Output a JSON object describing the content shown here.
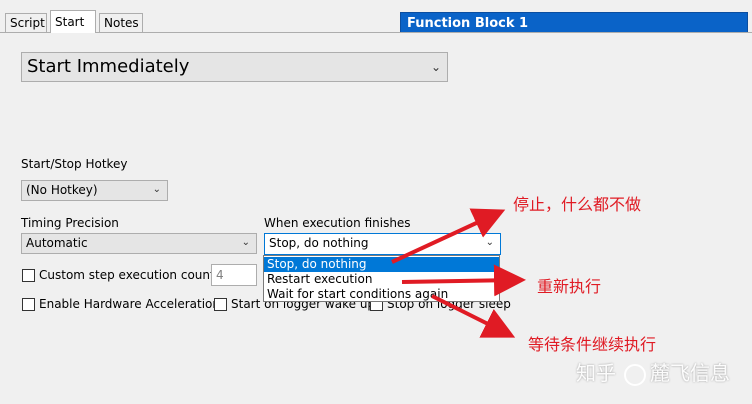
{
  "tabs": [
    {
      "label": "Script",
      "active": false
    },
    {
      "label": "Start",
      "active": true
    },
    {
      "label": "Notes",
      "active": false
    }
  ],
  "panel_title": "Function Block 1",
  "start_mode": {
    "value": "Start Immediately"
  },
  "hotkey": {
    "label": "Start/Stop Hotkey",
    "value": "(No Hotkey)"
  },
  "timing": {
    "label": "Timing Precision",
    "value": "Automatic"
  },
  "when_finishes": {
    "label": "When execution finishes",
    "value": "Stop, do nothing",
    "options": [
      "Stop, do nothing",
      "Restart execution",
      "Wait for start conditions again"
    ],
    "selected_index": 0
  },
  "custom_step": {
    "label": "Custom step execution count:",
    "value": "4",
    "checked": false
  },
  "hardware_accel": {
    "label": "Enable Hardware Acceleration",
    "checked": false
  },
  "logger_wake": {
    "label": "Start on logger wake up",
    "checked": false
  },
  "logger_sleep": {
    "label": "Stop on logger sleep",
    "checked": false
  },
  "annotations": [
    "停止，什么都不做",
    "重新执行",
    "等待条件继续执行"
  ],
  "watermark": {
    "left": "知乎",
    "right": "麓飞信息"
  },
  "colors": {
    "accent": "#0078d7",
    "title_bar": "#0a63c8",
    "annotation": "#e01b24"
  },
  "icons": [
    "chevron-down-icon",
    "checkbox-icon",
    "arrow-icon"
  ]
}
